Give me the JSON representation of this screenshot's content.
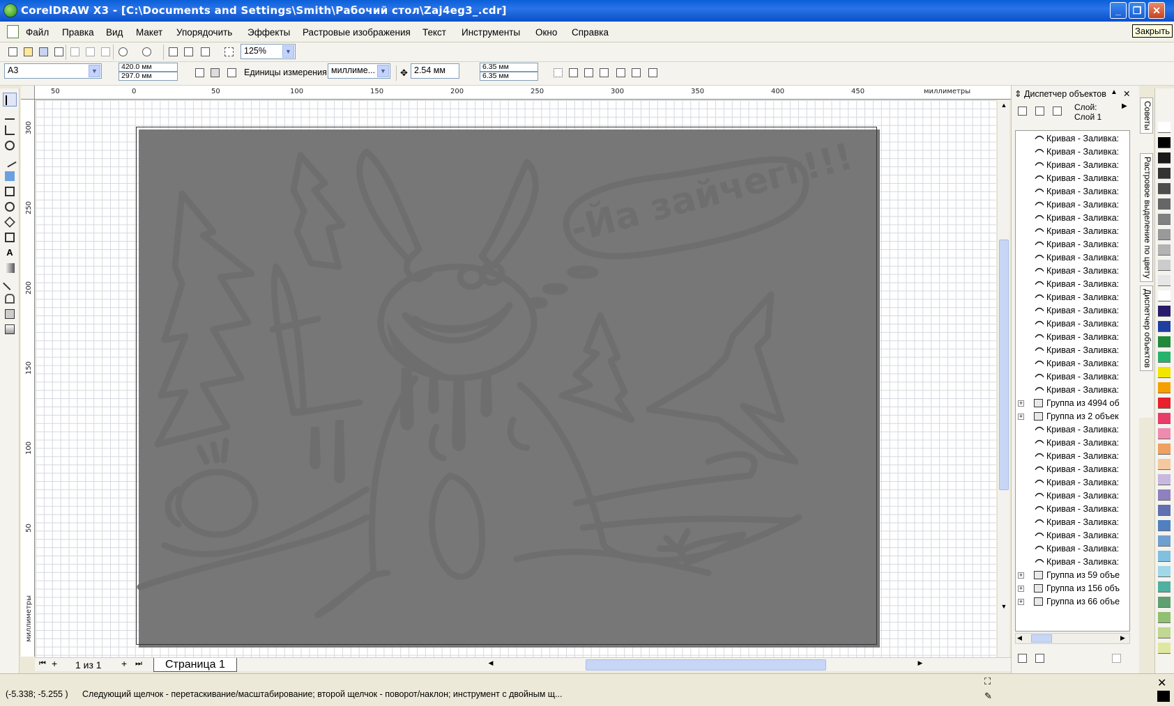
{
  "window": {
    "title": "CorelDRAW X3 - [C:\\Documents and Settings\\Smith\\Рабочий стол\\Zaj4eg3_.cdr]",
    "close_tooltip": "Закрыть"
  },
  "menu": [
    "Файл",
    "Правка",
    "Вид",
    "Макет",
    "Упорядочить",
    "Эффекты",
    "Растровые изображения",
    "Текст",
    "Инструменты",
    "Окно",
    "Справка"
  ],
  "standard_toolbar": {
    "zoom": "125%"
  },
  "property_bar": {
    "paper_size": "A3",
    "width": "420.0 мм",
    "height": "297.0 мм",
    "units_label": "Единицы измерения:",
    "units_value": "миллиме...",
    "nudge": "2.54 мм",
    "dup_x": "6.35 мм",
    "dup_y": "6.35 мм"
  },
  "ruler_h": {
    "labels": [
      "50",
      "0",
      "50",
      "100",
      "150",
      "200",
      "250",
      "300",
      "350",
      "400",
      "450"
    ],
    "unit": "миллиметры"
  },
  "ruler_v": {
    "labels": [
      "300",
      "250",
      "200",
      "150",
      "100",
      "50"
    ],
    "unit": "миллиметры"
  },
  "artwork": {
    "speech_bubble_text": "-Йа зайчегг!!!"
  },
  "page_nav": {
    "counter": "1 из 1",
    "page_tab": "Страница 1"
  },
  "docker": {
    "title": "Диспетчер объектов",
    "layer_label": "Слой:",
    "layer_value": "Слой 1",
    "tree": [
      {
        "type": "curve",
        "label": "Кривая - Заливка:"
      },
      {
        "type": "curve",
        "label": "Кривая - Заливка:"
      },
      {
        "type": "curve",
        "label": "Кривая - Заливка:"
      },
      {
        "type": "curve",
        "label": "Кривая - Заливка:"
      },
      {
        "type": "curve",
        "label": "Кривая - Заливка:"
      },
      {
        "type": "curve",
        "label": "Кривая - Заливка:"
      },
      {
        "type": "curve",
        "label": "Кривая - Заливка:"
      },
      {
        "type": "curve",
        "label": "Кривая - Заливка:"
      },
      {
        "type": "curve",
        "label": "Кривая - Заливка:"
      },
      {
        "type": "curve",
        "label": "Кривая - Заливка:"
      },
      {
        "type": "curve",
        "label": "Кривая - Заливка:"
      },
      {
        "type": "curve",
        "label": "Кривая - Заливка:"
      },
      {
        "type": "curve",
        "label": "Кривая - Заливка:"
      },
      {
        "type": "curve",
        "label": "Кривая - Заливка:"
      },
      {
        "type": "curve",
        "label": "Кривая - Заливка:"
      },
      {
        "type": "curve",
        "label": "Кривая - Заливка:"
      },
      {
        "type": "curve",
        "label": "Кривая - Заливка:"
      },
      {
        "type": "curve",
        "label": "Кривая - Заливка:"
      },
      {
        "type": "curve",
        "label": "Кривая - Заливка:"
      },
      {
        "type": "curve",
        "label": "Кривая - Заливка:"
      },
      {
        "type": "group",
        "label": "Группа из 4994 об"
      },
      {
        "type": "group",
        "label": "Группа из 2 объек"
      },
      {
        "type": "curve",
        "label": "Кривая - Заливка:"
      },
      {
        "type": "curve",
        "label": "Кривая - Заливка:"
      },
      {
        "type": "curve",
        "label": "Кривая - Заливка:"
      },
      {
        "type": "curve",
        "label": "Кривая - Заливка:"
      },
      {
        "type": "curve",
        "label": "Кривая - Заливка:"
      },
      {
        "type": "curve",
        "label": "Кривая - Заливка:"
      },
      {
        "type": "curve",
        "label": "Кривая - Заливка:"
      },
      {
        "type": "curve",
        "label": "Кривая - Заливка:"
      },
      {
        "type": "curve",
        "label": "Кривая - Заливка:"
      },
      {
        "type": "curve",
        "label": "Кривая - Заливка:"
      },
      {
        "type": "curve",
        "label": "Кривая - Заливка:"
      },
      {
        "type": "group",
        "label": "Группа из 59 объе"
      },
      {
        "type": "group",
        "label": "Группа из 156 объ"
      },
      {
        "type": "group",
        "label": "Группа из 66 объе"
      }
    ]
  },
  "docker_tabs": [
    "Советы",
    "Растровое выделение по цвету",
    "Диспетчер объектов"
  ],
  "palette": [
    "#ffffff",
    "#000000",
    "#1a1a1a",
    "#333333",
    "#4d4d4d",
    "#666666",
    "#808080",
    "#999999",
    "#b3b3b3",
    "#cccccc",
    "#e6e6e6",
    "#ffffff",
    "#2b1a6b",
    "#1f3fa0",
    "#1e8a3a",
    "#27b36b",
    "#f2e600",
    "#f5a000",
    "#e8202a",
    "#e83c6a",
    "#f08bb0",
    "#f0a060",
    "#f6c8a0",
    "#c8b8e0",
    "#9080c0",
    "#6070b0",
    "#5080c0",
    "#70a0d0",
    "#80c0e0",
    "#a0d8e8",
    "#50b0a0",
    "#60a070",
    "#90c070",
    "#c0d890",
    "#e0e8a0"
  ],
  "status": {
    "coords": "(-5.338; -5.255 )",
    "message": "Следующий щелчок - перетаскивание/масштабирование; второй щелчок - поворот/наклон; инструмент с двойным щ..."
  },
  "colors": {
    "artwork": "#6e6e6e",
    "titlebar": "#0a5fd8"
  }
}
